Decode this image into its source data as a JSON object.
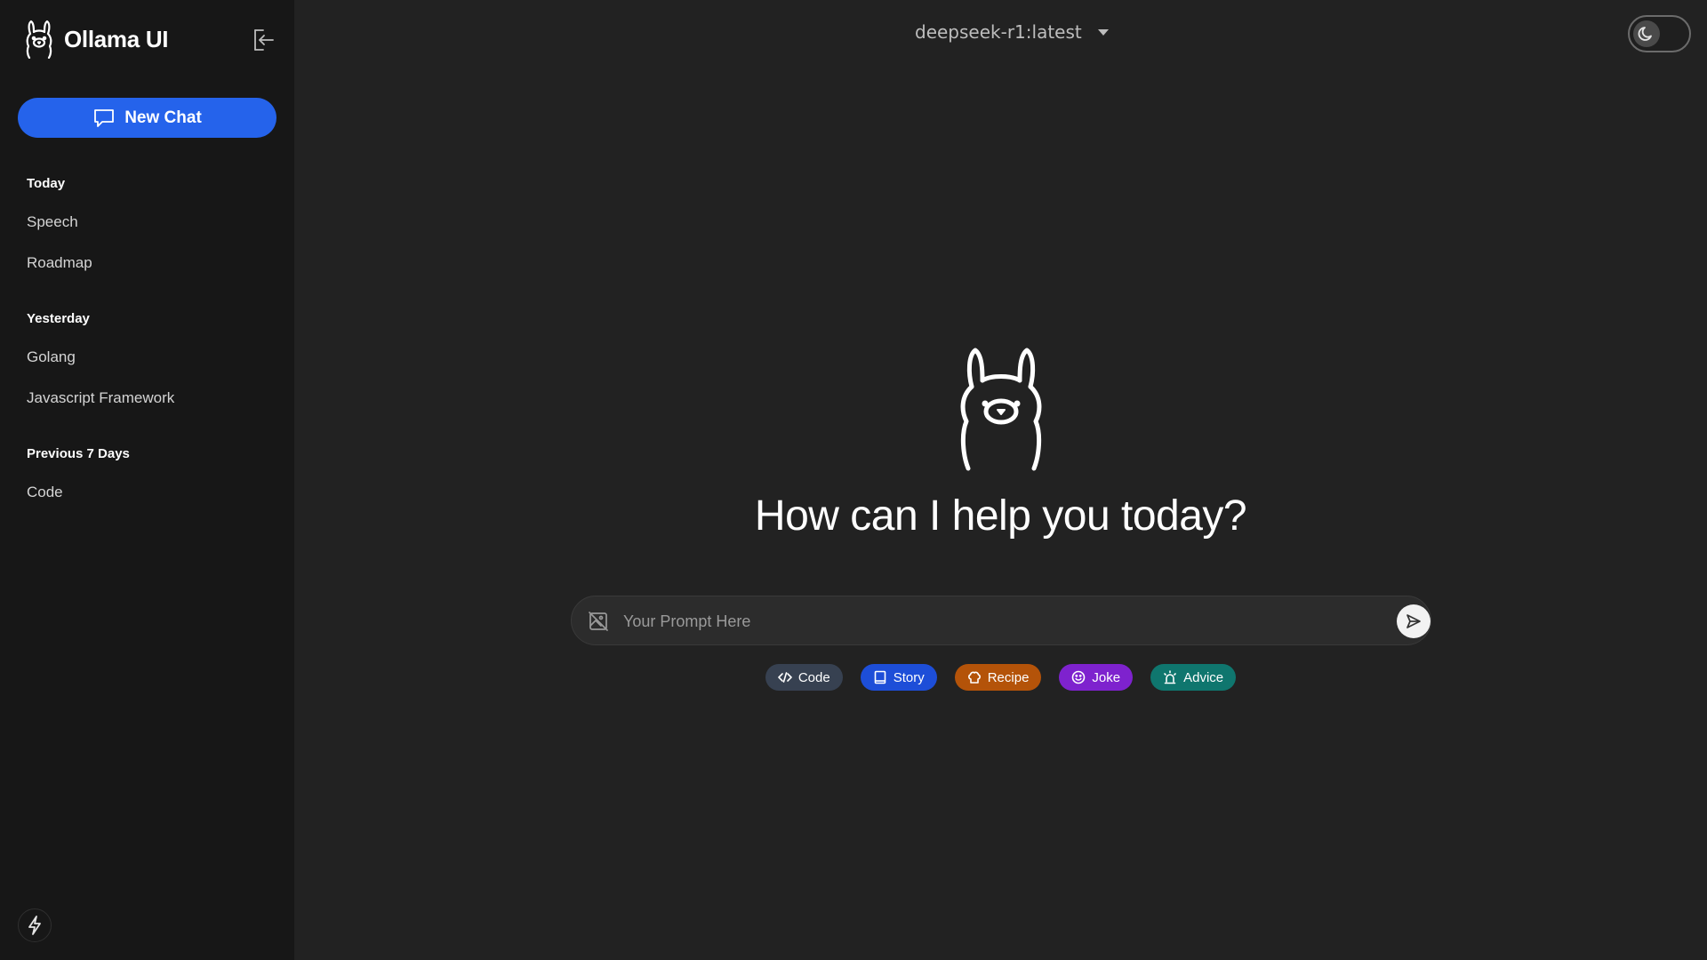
{
  "app": {
    "name": "Ollama UI"
  },
  "sidebar": {
    "new_chat_label": "New Chat",
    "sections": [
      {
        "heading": "Today",
        "items": [
          "Speech",
          "Roadmap"
        ]
      },
      {
        "heading": "Yesterday",
        "items": [
          "Golang",
          "Javascript Framework"
        ]
      },
      {
        "heading": "Previous 7 Days",
        "items": [
          "Code"
        ]
      }
    ]
  },
  "header": {
    "model": "deepseek-r1:latest",
    "theme": "dark"
  },
  "main": {
    "greeting": "How can I help you today?",
    "prompt": {
      "placeholder": "Your Prompt Here",
      "value": ""
    },
    "suggestions": [
      {
        "label": "Code",
        "icon": "code-icon",
        "color": "#374151"
      },
      {
        "label": "Story",
        "icon": "book-icon",
        "color": "#1d4ed8"
      },
      {
        "label": "Recipe",
        "icon": "chef-hat-icon",
        "color": "#b45309"
      },
      {
        "label": "Joke",
        "icon": "smile-icon",
        "color": "#7e22ce"
      },
      {
        "label": "Advice",
        "icon": "siren-icon",
        "color": "#0f766e"
      }
    ]
  },
  "colors": {
    "accent": "#2563eb",
    "sidebar_bg": "#171717",
    "main_bg": "#222222"
  }
}
